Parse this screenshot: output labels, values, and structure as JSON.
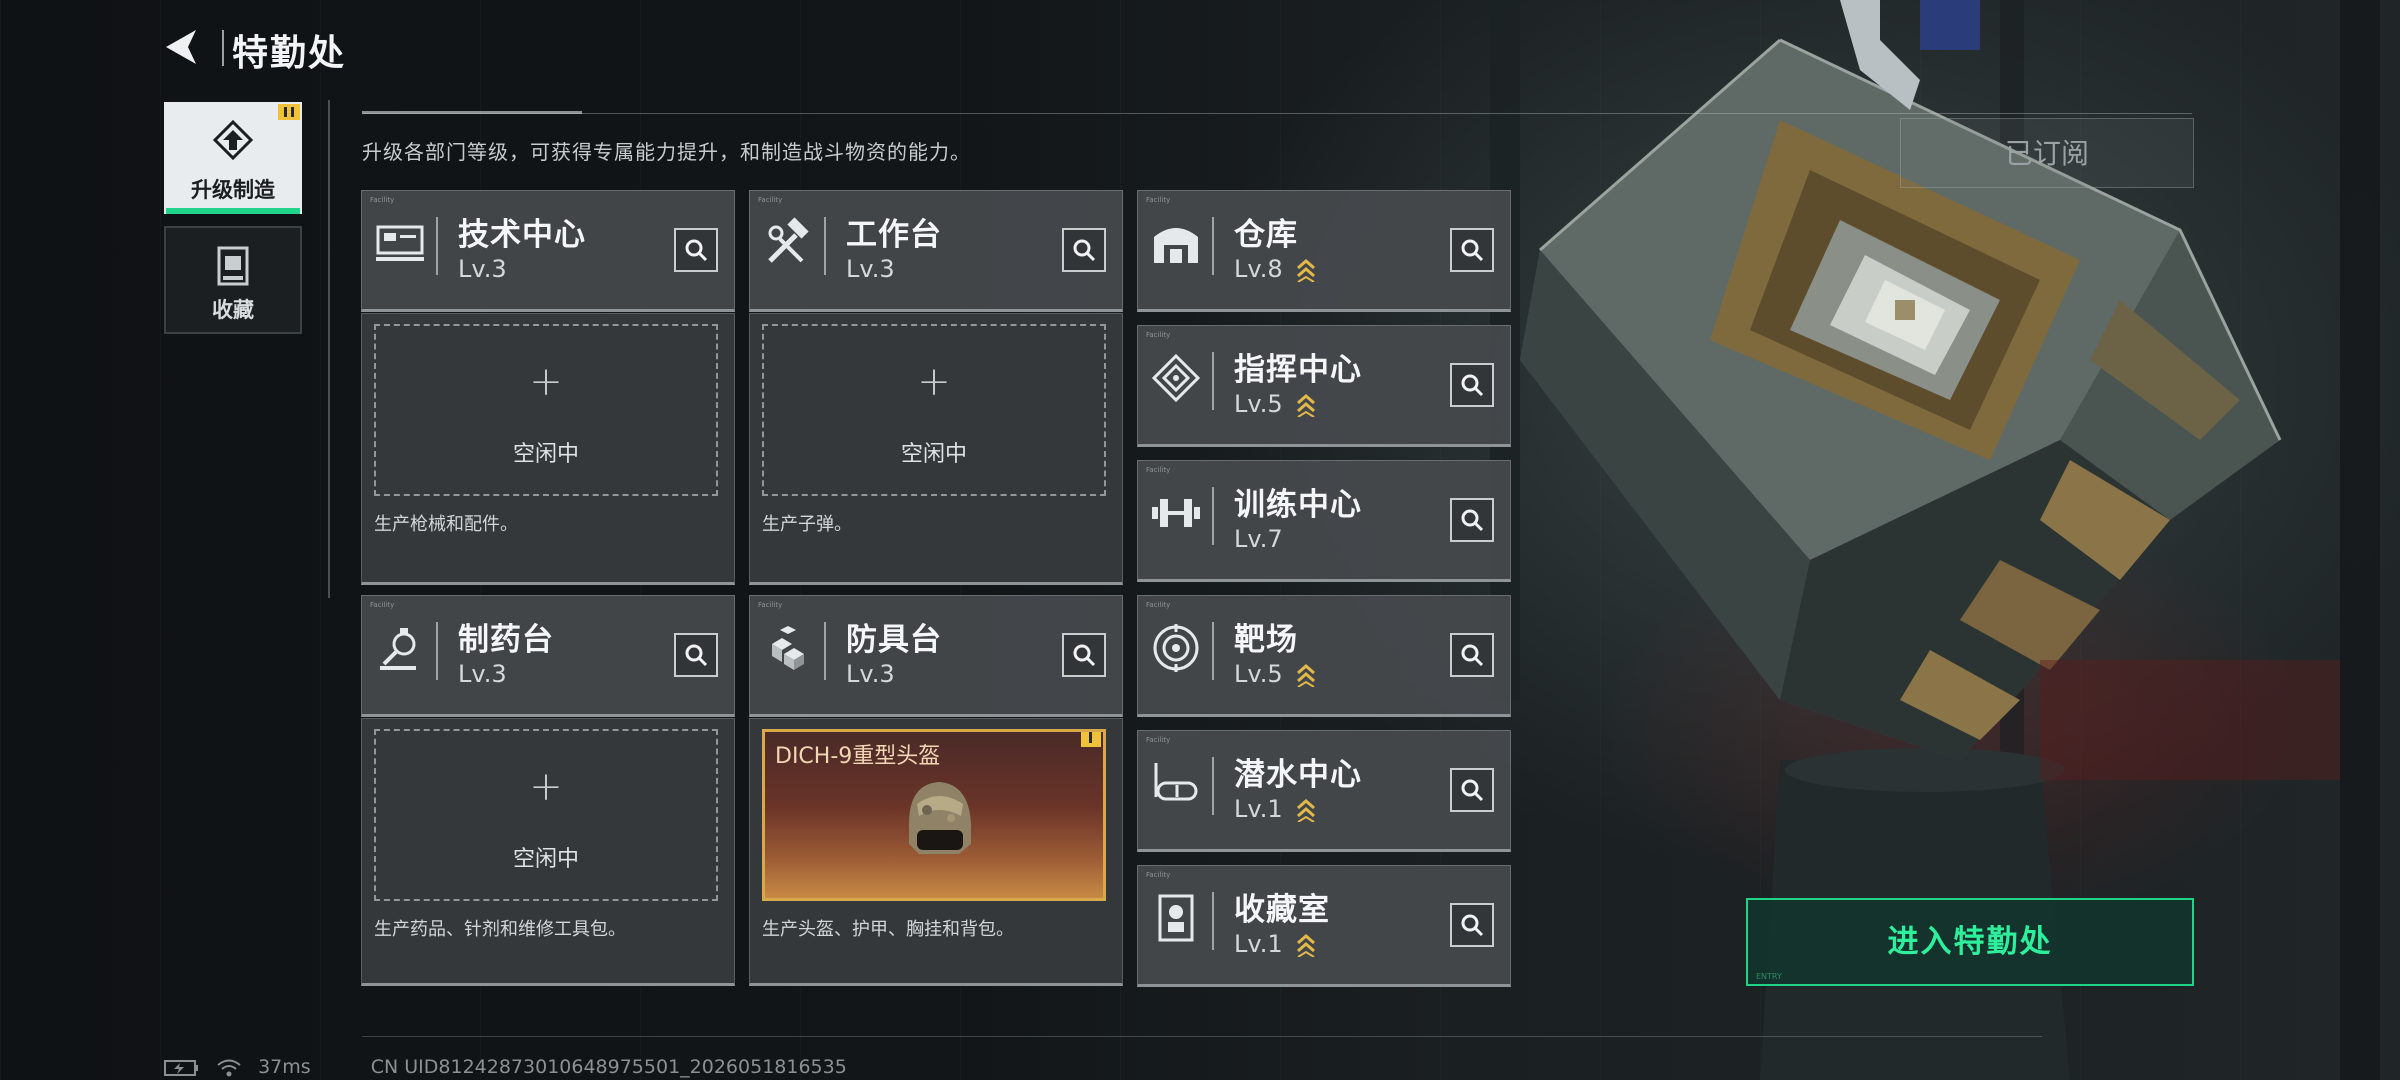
{
  "header": {
    "title": "特勤处"
  },
  "tabs": [
    {
      "label": "升级制造",
      "icon": "upgrade-icon"
    },
    {
      "label": "收藏",
      "icon": "collection-icon"
    }
  ],
  "subtitle": "升级各部门等级，可获得专属能力提升，和制造战斗物资的能力。",
  "subscribed_label": "已订阅",
  "enter_button": "进入特勤处",
  "enter_button_micro": "ENTRY",
  "micro_label": "Facility",
  "idle_label": "空闲中",
  "facilities": [
    {
      "name": "技术中心",
      "level": "Lv.3",
      "icon": "tech-center-icon",
      "desc": "生产枪械和配件。"
    },
    {
      "name": "工作台",
      "level": "Lv.3",
      "icon": "workbench-icon",
      "desc": "生产子弹。"
    },
    {
      "name": "仓库",
      "level": "Lv.8",
      "icon": "warehouse-icon",
      "upgradable": true
    },
    {
      "name": "指挥中心",
      "level": "Lv.5",
      "icon": "command-center-icon",
      "upgradable": true
    },
    {
      "name": "训练中心",
      "level": "Lv.7",
      "icon": "training-center-icon"
    },
    {
      "name": "制药台",
      "level": "Lv.3",
      "icon": "pharmacy-icon",
      "desc": "生产药品、针剂和维修工具包。"
    },
    {
      "name": "防具台",
      "level": "Lv.3",
      "icon": "armor-bench-icon",
      "desc": "生产头盔、护甲、胸挂和背包。",
      "product": "DICH-9重型头盔"
    },
    {
      "name": "靶场",
      "level": "Lv.5",
      "icon": "shooting-range-icon",
      "upgradable": true
    },
    {
      "name": "潜水中心",
      "level": "Lv.1",
      "icon": "diving-center-icon",
      "upgradable": true
    },
    {
      "name": "收藏室",
      "level": "Lv.1",
      "icon": "collection-room-icon",
      "upgradable": true
    }
  ],
  "footer": {
    "ping": "37ms",
    "uid": "CN UID81242873010648975501_2026051816535"
  },
  "colors": {
    "accent": "#22d38a",
    "badge": "#f0c33a",
    "upgrade": "#e2b84a"
  }
}
